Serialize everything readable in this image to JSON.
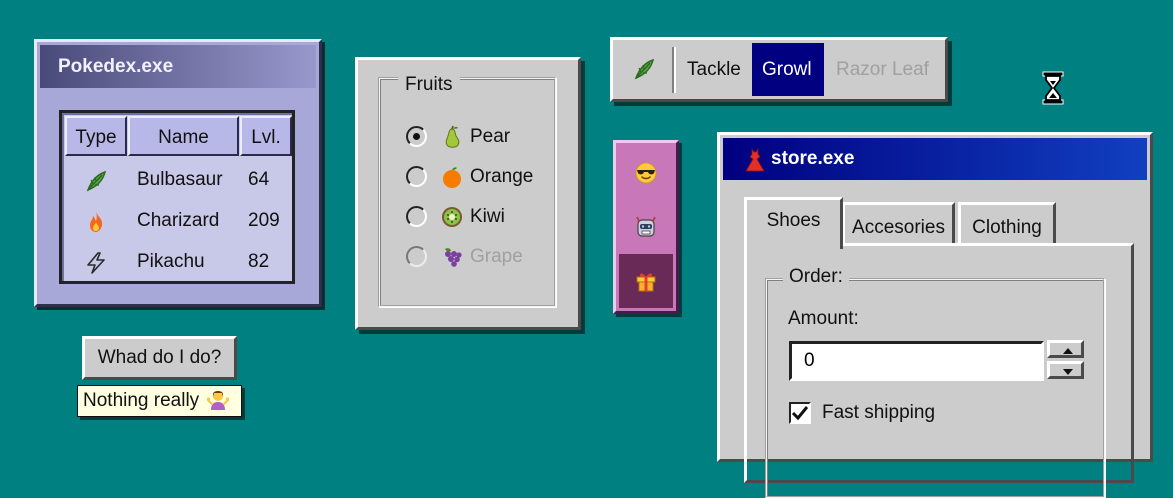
{
  "pokedex": {
    "title": "Pokedex.exe",
    "columns": [
      "Type",
      "Name",
      "Lvl."
    ],
    "rows": [
      {
        "type_icon": "leaf-icon",
        "name": "Bulbasaur",
        "level": "64"
      },
      {
        "type_icon": "fire-icon",
        "name": "Charizard",
        "level": "209"
      },
      {
        "type_icon": "lightning-icon",
        "name": "Pikachu",
        "level": "82"
      }
    ]
  },
  "help_button": {
    "label": "Whad do I do?"
  },
  "tooltip": {
    "text": "Nothing really",
    "icon": "person-shrugging-icon"
  },
  "fruits": {
    "legend": "Fruits",
    "options": [
      {
        "label": "Pear",
        "icon": "pear-icon",
        "checked": true,
        "disabled": false
      },
      {
        "label": "Orange",
        "icon": "orange-icon",
        "checked": false,
        "disabled": false
      },
      {
        "label": "Kiwi",
        "icon": "kiwi-icon",
        "checked": false,
        "disabled": false
      },
      {
        "label": "Grape",
        "icon": "grape-icon",
        "checked": false,
        "disabled": true
      }
    ]
  },
  "moves": {
    "icon": "leaf-icon",
    "items": [
      {
        "label": "Tackle",
        "state": "normal"
      },
      {
        "label": "Growl",
        "state": "active"
      },
      {
        "label": "Razor Leaf",
        "state": "disabled"
      }
    ]
  },
  "emoji_bar": {
    "items": [
      {
        "icon": "sunglasses-face-icon",
        "selected": false
      },
      {
        "icon": "robot-icon",
        "selected": false
      },
      {
        "icon": "gift-icon",
        "selected": true
      }
    ],
    "color": "#c878b8"
  },
  "store": {
    "title": "store.exe",
    "title_icon": "dress-icon",
    "tabs": [
      "Shoes",
      "Accesories",
      "Clothing"
    ],
    "active_tab": "Shoes",
    "order": {
      "legend": "Order:",
      "amount_label": "Amount:",
      "amount_value": "0",
      "fast_shipping_label": "Fast shipping",
      "fast_shipping_checked": true
    }
  },
  "colors": {
    "desktop": "#008080",
    "title_bar": "#000080",
    "pokedex_panel": "#a8a8d8"
  }
}
